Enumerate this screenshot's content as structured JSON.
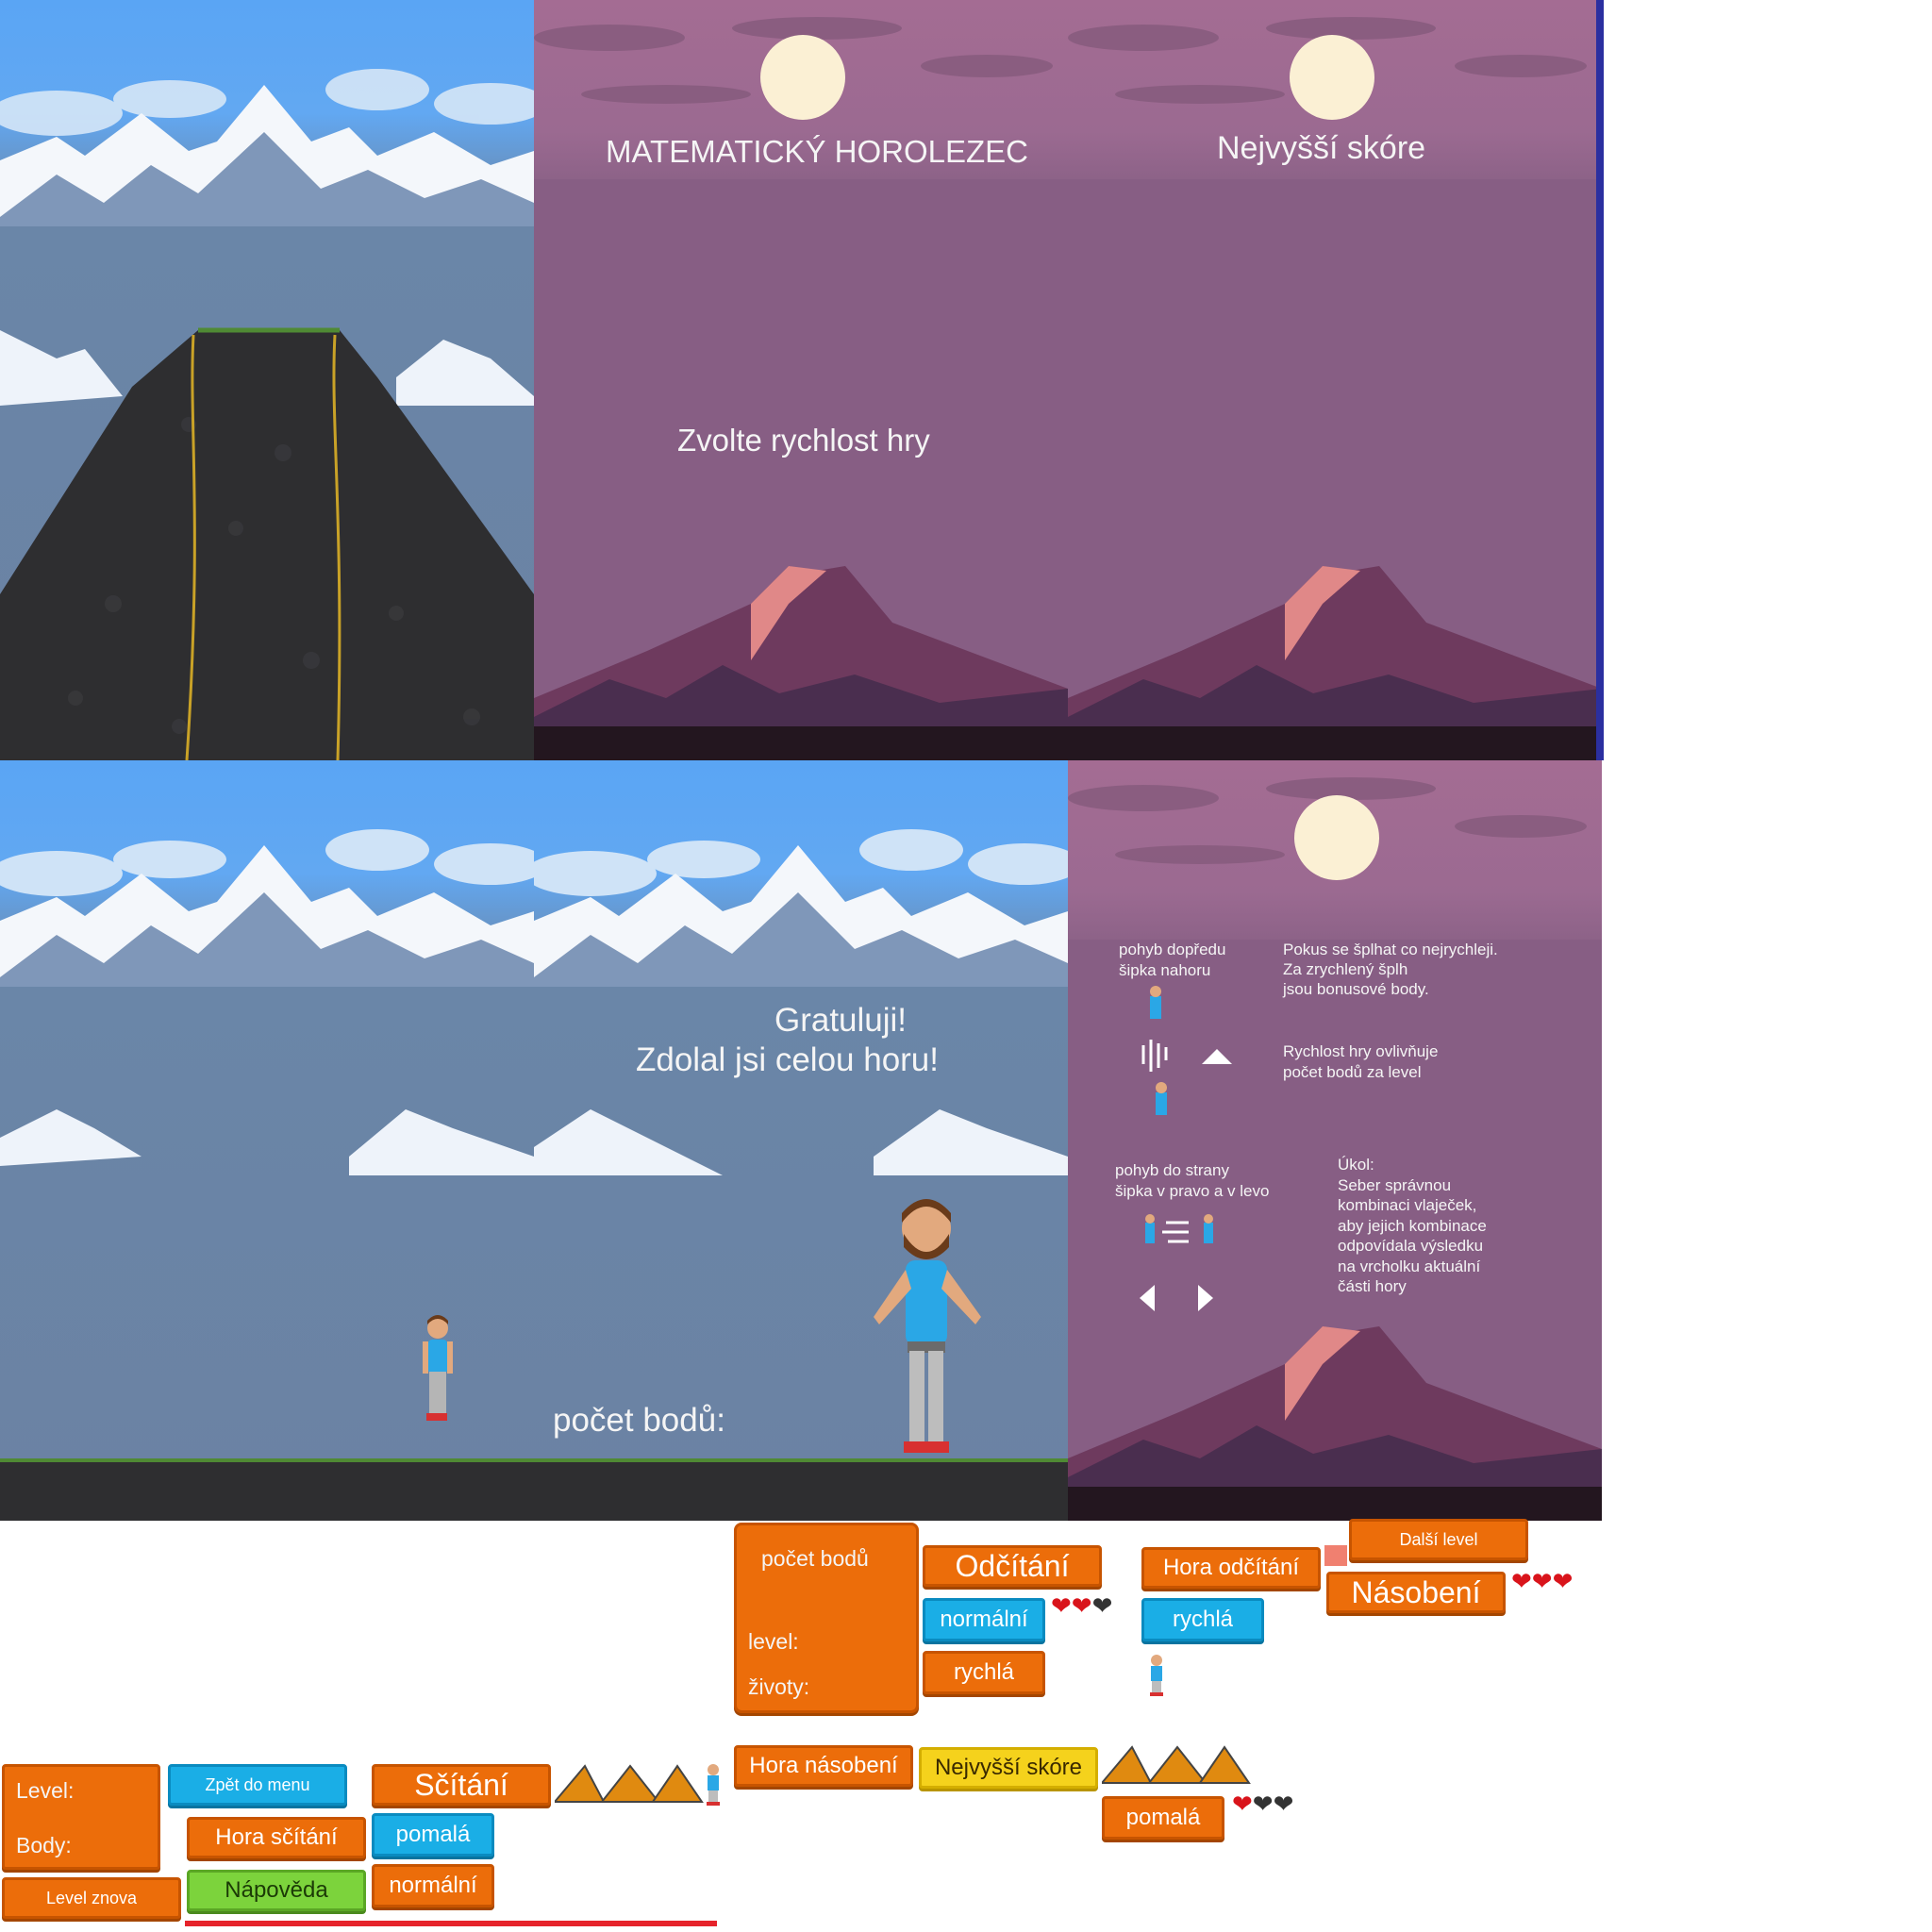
{
  "menu": {
    "title": "MATEMATICKÝ HOROLEZEC"
  },
  "highscore": {
    "title": "Nejvyšší skóre"
  },
  "speed_screen": {
    "title": "Zvolte rychlost hry"
  },
  "congrats": {
    "line1": "Gratuluji!",
    "line2": "Zdolal jsi celou horu!",
    "points_label": "počet bodů:"
  },
  "help": {
    "forward_line1": "pohyb dopředu",
    "forward_line2": "šipka nahoru",
    "tip_line1": "Pokus se šplhat co nejrychleji.",
    "tip_line2": "Za zrychlený šplh",
    "tip_line3": "jsou bonusové body.",
    "speed_line1": "Rychlost hry ovlivňuje",
    "speed_line2": "počet bodů za level",
    "side_line1": "pohyb do strany",
    "side_line2": "šipka v pravo a v levo",
    "task_title": "Úkol:",
    "task_line1": "Seber správnou",
    "task_line2": "kombinaci vlaječek,",
    "task_line3": "aby jejich kombinace",
    "task_line4": "odpovídala výsledku",
    "task_line5": "na vrcholku aktuální",
    "task_line6": "části hory"
  },
  "hud": {
    "points": "počet bodů",
    "level": "level:",
    "lives": "životy:"
  },
  "hud_small": {
    "level": "Level:",
    "points": "Body:"
  },
  "buttons": {
    "odcitani": "Odčítání",
    "normalni": "normální",
    "rychla": "rychlá",
    "hora_odcitani": "Hora odčítání",
    "rychla2": "rychlá",
    "dalsi_level": "Další level",
    "nasobeni": "Násobení",
    "zpet_do_menu": "Zpět do menu",
    "scitani": "Sčítání",
    "hora_scitani": "Hora sčítání",
    "pomala": "pomalá",
    "napoveda": "Nápověda",
    "normalni2": "normální",
    "level_znova": "Level znova",
    "hora_nasobeni": "Hora násobení",
    "nejvyssi_skore": "Nejvyšší skóre",
    "pomala2": "pomalá"
  },
  "lives": {
    "set_a": [
      "full",
      "full",
      "empty"
    ],
    "set_b": [
      "full",
      "full",
      "full"
    ],
    "set_c": [
      "full",
      "empty",
      "empty"
    ]
  },
  "colors": {
    "sky_blue": "#5aa5f4",
    "sky_purple": "#875e84",
    "orange": "#ec6d0a",
    "blue": "#1aaee6",
    "green": "#7cd33c",
    "yellow": "#f5d21c",
    "heart": "#d9141b"
  }
}
